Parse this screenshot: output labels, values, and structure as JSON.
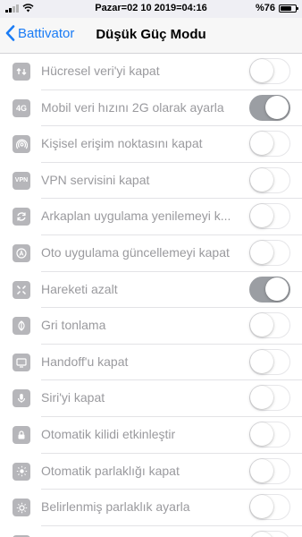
{
  "status_bar": {
    "datetime": "Pazar=02 10 2019=04:16",
    "battery": "%76",
    "battery_level": 0.76
  },
  "nav": {
    "back_label": "Battivator",
    "title": "Düşük Güç Modu"
  },
  "colors": {
    "accent": "#1a7cf5",
    "toggle_on": "#9b9ea3",
    "label_disabled": "#9a9a9e",
    "icon_bg": "#b6b6ba"
  },
  "rows": [
    {
      "label": "Hücresel veri'yi kapat",
      "icon": "cellular-icon",
      "on": false
    },
    {
      "label": "Mobil veri hızını 2G olarak ayarla",
      "icon": "4g-icon",
      "icon_text": "4G",
      "on": true
    },
    {
      "label": "Kişisel erişim noktasını kapat",
      "icon": "hotspot-icon",
      "on": false
    },
    {
      "label": "VPN servisini kapat",
      "icon": "vpn-icon",
      "icon_text": "VPN",
      "on": false
    },
    {
      "label": "Arkaplan uygulama yenilemeyi k...",
      "icon": "refresh-icon",
      "on": false
    },
    {
      "label": "Oto uygulama güncellemeyi kapat",
      "icon": "app-store-icon",
      "on": false
    },
    {
      "label": "Hareketi azalt",
      "icon": "reduce-motion-icon",
      "on": true
    },
    {
      "label": "Gri tonlama",
      "icon": "grayscale-icon",
      "on": false
    },
    {
      "label": "Handoff'u kapat",
      "icon": "handoff-icon",
      "on": false
    },
    {
      "label": "Siri'yi kapat",
      "icon": "siri-icon",
      "on": false
    },
    {
      "label": "Otomatik kilidi etkinleştir",
      "icon": "auto-lock-icon",
      "on": false
    },
    {
      "label": "Otomatik parlaklığı kapat",
      "icon": "auto-brightness-icon",
      "on": false
    },
    {
      "label": "Belirlenmiş parlaklık ayarla",
      "icon": "brightness-icon",
      "on": false
    },
    {
      "label": "",
      "icon": "blank-icon",
      "on": false
    }
  ]
}
